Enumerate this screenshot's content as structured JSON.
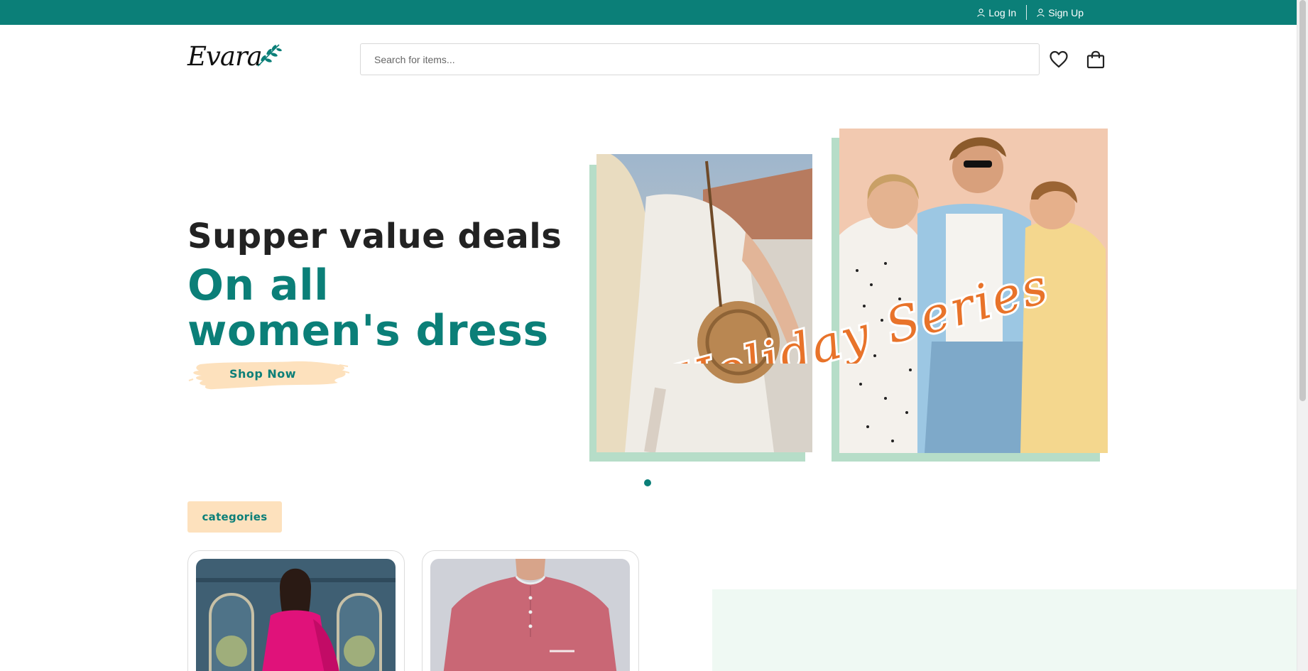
{
  "topbar": {
    "login_label": "Log In",
    "signup_label": "Sign Up"
  },
  "header": {
    "logo_text": "Evara",
    "search_placeholder": "Search for items...",
    "wishlist_icon": "heart-icon",
    "cart_icon": "shopping-bag-icon"
  },
  "hero": {
    "line1": "Supper value deals",
    "line2": "On all women's dress",
    "button_label": "Shop Now",
    "overlay_script": "Holiday Series"
  },
  "slider": {
    "active_index": 1,
    "dot_count": 1
  },
  "categories": {
    "tag_label": "categories",
    "cards": [
      {
        "image": "woman-pink-ethnic-dress"
      },
      {
        "image": "man-pink-kurta-shirt"
      }
    ]
  },
  "colors": {
    "brand_teal": "#0b7f78",
    "accent_peach": "#fde1bd",
    "mint_frame": "#b6ddc8",
    "script_orange": "#e8732a",
    "panel_mint": "#eff9f3"
  }
}
